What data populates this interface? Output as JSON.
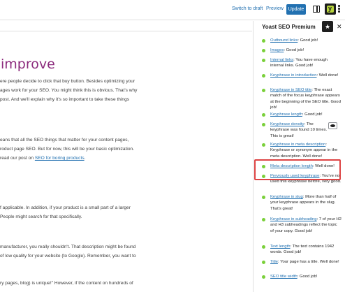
{
  "topbar": {
    "switch_to_draft": "Switch to draft",
    "preview": "Preview",
    "update": "Update",
    "yoast_letter": "y"
  },
  "editor": {
    "heading": "improve",
    "para1": [
      "ere people decide to click that buy button. Besides optimizing your",
      "ages work for your SEO. You might think this is obvious. That's why",
      "post. And we'll explain why it's so important to take these things"
    ],
    "para2_line1": "eans that all the SEO things that matter for your content pages,",
    "para2_line2": "roduct page SEO. But for now, this will be your basic optimization.",
    "para2_line3_prefix": "read our post on ",
    "para2_line3_link": "SEO for boring products",
    "para2_line3_suffix": ".",
    "para3": [
      "f applicable. In addition, if your product is a small part of a larger",
      "People might search for that specifically."
    ],
    "para4": [
      " manufacturer, you really shouldn't. That description might be found",
      "of low quality for your website (to Google). Remember, you want to"
    ],
    "para5": "ry pages, blog) is unique!\" However, if the content on hundreds of"
  },
  "sidebar": {
    "title": "Yoast SEO Premium",
    "results": [
      {
        "link": "Outbound links",
        "text": ": Good job!"
      },
      {
        "link": "Images",
        "text": ": Good job!"
      },
      {
        "link": "Internal links",
        "text": ": You have enough internal links. Good job!"
      },
      {
        "link": "Keyphrase in introduction",
        "text": ": Well done!"
      },
      {
        "link": "Keyphrase in SEO title",
        "text": ": The exact match of the focus keyphrase appears at the beginning of the SEO title. Good job!"
      },
      {
        "link": "Keyphrase length",
        "text": ": Good job!"
      },
      {
        "link": "Keyphrase density",
        "text": ": The keyphrase was found 10 times. This is great!"
      },
      {
        "link": "Keyphrase in meta description",
        "text": ": Keyphrase or synonym appear in the meta description. Well done!"
      },
      {
        "link": "Meta description length",
        "text": ": Well done!"
      },
      {
        "link": "Previously used keyphrase",
        "text": ": You've not used this keyphrase before, very good."
      },
      {
        "link": "Keyphrase in slug",
        "text": ": More than half of your keyphrase appears in the slug. That's great!"
      },
      {
        "link": "Keyphrase in subheading",
        "text": ": 7 of your H2 and H3 subheadings reflect the topic of your copy. Good job!"
      },
      {
        "link": "Text length",
        "text": ": The text contains 1942 words. Good job!"
      },
      {
        "link": "Title",
        "text": ": Your page has a title. Well done!"
      },
      {
        "link": "SEO title width",
        "text": ": Good job!"
      }
    ]
  },
  "colors": {
    "accent": "#2271b1",
    "heading": "#8c2b7d",
    "good": "#7ad03a",
    "highlight": "#dd4444"
  }
}
